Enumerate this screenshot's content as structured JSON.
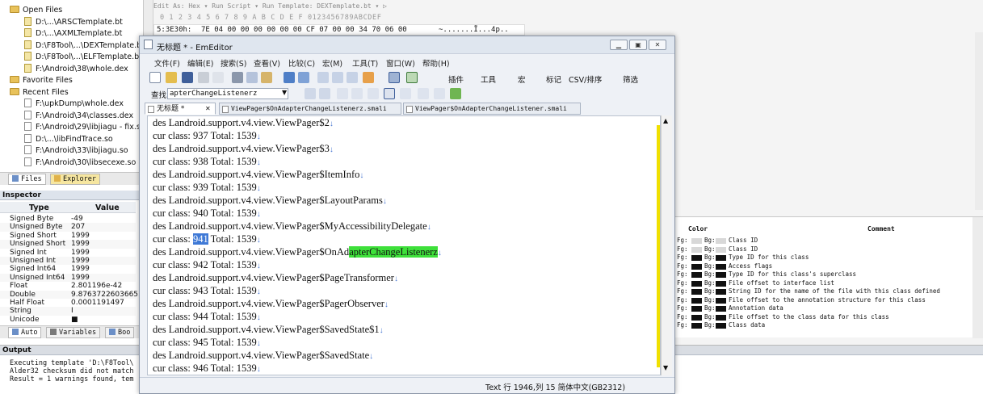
{
  "files_panel": {
    "open_files_label": "Open Files",
    "open_files": [
      "D:\\...\\ARSCTemplate.bt",
      "D:\\...\\AXMLTemplate.bt",
      "D:\\F8Tool\\...\\DEXTemplate.bt",
      "D:\\F8Tool\\...\\ELFTemplate.bt",
      "F:\\Android\\38\\whole.dex"
    ],
    "favorite_files_label": "Favorite Files",
    "recent_files_label": "Recent Files",
    "recent_files": [
      "F:\\upkDump\\whole.dex",
      "F:\\Android\\34\\classes.dex",
      "F:\\Android\\29\\libjiagu - fix.so",
      "D:\\...\\libFindTrace.so",
      "F:\\Android\\33\\libjiagu.so",
      "F:\\Android\\30\\libsecexe.so"
    ],
    "tabs": [
      "Files",
      "Explorer"
    ]
  },
  "inspector": {
    "title": "Inspector",
    "col_type": "Type",
    "col_value": "Value",
    "rows": [
      {
        "type": "Signed Byte",
        "value": "-49"
      },
      {
        "type": "Unsigned Byte",
        "value": "207"
      },
      {
        "type": "Signed Short",
        "value": "1999"
      },
      {
        "type": "Unsigned Short",
        "value": "1999"
      },
      {
        "type": "Signed Int",
        "value": "1999"
      },
      {
        "type": "Unsigned Int",
        "value": "1999"
      },
      {
        "type": "Signed Int64",
        "value": "1999"
      },
      {
        "type": "Unsigned Int64",
        "value": "1999"
      },
      {
        "type": "Float",
        "value": "2.801196e-42"
      },
      {
        "type": "Double",
        "value": "9.8763722603665..."
      },
      {
        "type": "Half Float",
        "value": "0.0001191497"
      },
      {
        "type": "String",
        "value": "I"
      },
      {
        "type": "Unicode",
        "value": "■"
      }
    ],
    "tabs": [
      "Auto",
      "Variables",
      "Boo"
    ]
  },
  "output": {
    "title": "Output",
    "lines": [
      "Executing template 'D:\\F8Tool\\",
      "Alder32 checksum did not match",
      "Result = 1 warnings found, tem"
    ]
  },
  "hex": {
    "toolbar": "Edit As: Hex ▾   Run Script ▾   Run Template: DEXTemplate.bt ▾  ▷",
    "columns": "0  1  2  3  4  5  6  7  8  9  A  B  C  D  E  F   0123456789ABCDEF",
    "row_address": "5:3E30h:",
    "row_bytes": "7E 04 00 00 00 00 00 00 CF 07 00 00 34 70 06 00",
    "row_ascii": "~.......Ï...4p.."
  },
  "template_results": {
    "col_color": "Color",
    "col_comment": "Comment",
    "rows": [
      {
        "swatch": "gray",
        "comment": "Class ID"
      },
      {
        "swatch": "gray",
        "comment": "Class ID"
      },
      {
        "swatch": "black",
        "comment": "Type ID for this class"
      },
      {
        "swatch": "black",
        "comment": "Access flags"
      },
      {
        "swatch": "black",
        "comment": "Type ID for this class's superclass"
      },
      {
        "swatch": "black",
        "comment": "File offset to interface list"
      },
      {
        "swatch": "black",
        "comment": "String ID for the name of the file with this class defined"
      },
      {
        "swatch": "black",
        "comment": "File offset to the annotation structure for this class"
      },
      {
        "swatch": "black",
        "comment": "Annotation data"
      },
      {
        "swatch": "black",
        "comment": "File offset to the class data for this class"
      },
      {
        "swatch": "black",
        "comment": "Class data"
      }
    ],
    "fg_label": "Fg:",
    "bg_label": "Bg:"
  },
  "emeditor": {
    "title": "无标题 * - EmEditor",
    "menu": [
      "文件(F)",
      "编辑(E)",
      "搜索(S)",
      "查看(V)",
      "比较(C)",
      "宏(M)",
      "工具(T)",
      "窗口(W)",
      "帮助(H)"
    ],
    "toolbar_labels": [
      "插件",
      "工具",
      "宏",
      "标记",
      "CSV/排序",
      "筛选"
    ],
    "find_label": "查找",
    "find_value": "apterChangeListenerz",
    "tabs": [
      "无标题 *",
      "ViewPager$OnAdapterChangeListenerz.smali",
      "ViewPager$OnAdapterChangeListener.smali"
    ],
    "lines": [
      {
        "text": "des Landroid.support.v4.view.ViewPager$2"
      },
      {
        "text": "cur class: 937 Total: 1539"
      },
      {
        "text": "des Landroid.support.v4.view.ViewPager$3"
      },
      {
        "text": "cur class: 938 Total: 1539"
      },
      {
        "text": "des Landroid.support.v4.view.ViewPager$ItemInfo"
      },
      {
        "text": "cur class: 939 Total: 1539"
      },
      {
        "text": "des Landroid.support.v4.view.ViewPager$LayoutParams"
      },
      {
        "text": "cur class: 940 Total: 1539"
      },
      {
        "text": "des Landroid.support.v4.view.ViewPager$MyAccessibilityDelegate"
      },
      {
        "pre": "cur class: ",
        "sel": "941",
        "post": " Total: 1539"
      },
      {
        "pre": "des Landroid.support.v4.view.ViewPager$OnAd",
        "find": "apterChangeListenerz",
        "post": ""
      },
      {
        "text": "cur class: 942 Total: 1539"
      },
      {
        "text": "des Landroid.support.v4.view.ViewPager$PageTransformer"
      },
      {
        "text": "cur class: 943 Total: 1539"
      },
      {
        "text": "des Landroid.support.v4.view.ViewPager$PagerObserver"
      },
      {
        "text": "cur class: 944 Total: 1539"
      },
      {
        "text": "des Landroid.support.v4.view.ViewPager$SavedState$1"
      },
      {
        "text": "cur class: 945 Total: 1539"
      },
      {
        "text": "des Landroid.support.v4.view.ViewPager$SavedState"
      },
      {
        "text": "cur class: 946 Total: 1539"
      }
    ],
    "line_end_mark": "↓",
    "status": "Text 行 1946,列 15  简体中文(GB2312)"
  }
}
